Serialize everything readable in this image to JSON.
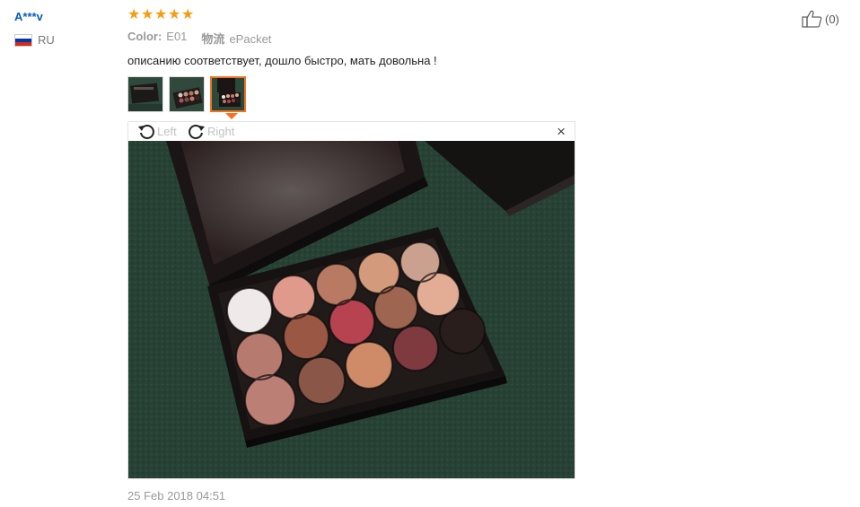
{
  "user": {
    "name": "A***v",
    "country": "RU"
  },
  "rating": {
    "stars": 5
  },
  "meta": {
    "color_label": "Color:",
    "color_value": "E01",
    "logistics_label": "物流",
    "logistics_value": "ePacket"
  },
  "review": {
    "text": "описанию соответствует, дошло быстро, мать довольна !"
  },
  "viewer": {
    "rotate_left_label": "Left",
    "rotate_right_label": "Right",
    "close_symbol": "×"
  },
  "like": {
    "count_text": "(0)"
  },
  "date": "25 Feb 2018 04:51",
  "colors": {
    "accent": "#f57224",
    "star": "#f59d10",
    "link": "#0a5ebf"
  }
}
